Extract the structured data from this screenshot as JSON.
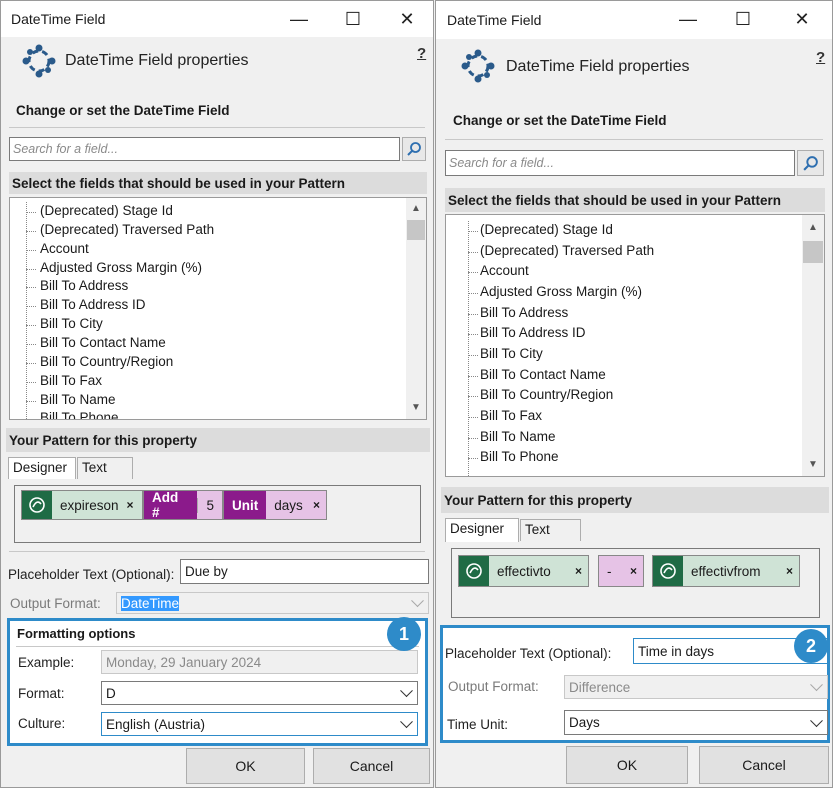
{
  "left": {
    "window_title": "DateTime Field",
    "header_title": "DateTime Field properties",
    "help": "?",
    "subtitle": "Change or set the DateTime Field",
    "search_placeholder": "Search for a field...",
    "fields_header": "Select the fields that should be used in your Pattern",
    "fields": [
      "(Deprecated) Stage Id",
      "(Deprecated) Traversed Path",
      "Account",
      "Adjusted Gross Margin (%)",
      "Bill To Address",
      "Bill To Address ID",
      "Bill To City",
      "Bill To Contact Name",
      "Bill To Country/Region",
      "Bill To Fax",
      "Bill To Name",
      "Bill To Phone"
    ],
    "pattern_header": "Your Pattern for this property",
    "tab_designer": "Designer",
    "tab_text": "Text",
    "chips": {
      "c1": "expireson",
      "c1x": "×",
      "c2": "Add #",
      "c2val": "5",
      "c3": "Unit",
      "c3val": "days",
      "c3x": "×"
    },
    "placeholder_label": "Placeholder Text (Optional):",
    "placeholder_value": "Due by",
    "output_label": "Output Format:",
    "output_value": "DateTime",
    "formatting_title": "Formatting options",
    "example_label": "Example:",
    "example_value": "Monday, 29 January 2024",
    "format_label": "Format:",
    "format_value": "D",
    "culture_label": "Culture:",
    "culture_value": "English (Austria)",
    "ok": "OK",
    "cancel": "Cancel",
    "badge": "1"
  },
  "right": {
    "window_title": "DateTime Field",
    "header_title": "DateTime Field properties",
    "help": "?",
    "subtitle": "Change or set the DateTime Field",
    "search_placeholder": "Search for a field...",
    "fields_header": "Select the fields that should be used in your Pattern",
    "fields": [
      "(Deprecated) Stage Id",
      "(Deprecated) Traversed Path",
      "Account",
      "Adjusted Gross Margin (%)",
      "Bill To Address",
      "Bill To Address ID",
      "Bill To City",
      "Bill To Contact Name",
      "Bill To Country/Region",
      "Bill To Fax",
      "Bill To Name",
      "Bill To Phone"
    ],
    "pattern_header": "Your Pattern for this property",
    "tab_designer": "Designer",
    "tab_text": "Text",
    "chips": {
      "c1": "effectivto",
      "c1x": "×",
      "c2": "-",
      "c2x": "×",
      "c3": "effectivfrom",
      "c3x": "×"
    },
    "placeholder_label": "Placeholder Text (Optional):",
    "placeholder_value": "Time in days",
    "output_label": "Output Format:",
    "output_value": "Difference",
    "timeunit_label": "Time Unit:",
    "timeunit_value": "Days",
    "ok": "OK",
    "cancel": "Cancel",
    "badge": "2"
  },
  "colors": {
    "highlight": "#2e8bc9",
    "chip_green": "#1f6b45",
    "chip_purple": "#8b1a8b",
    "chip_lilac": "#e6c3e6"
  }
}
